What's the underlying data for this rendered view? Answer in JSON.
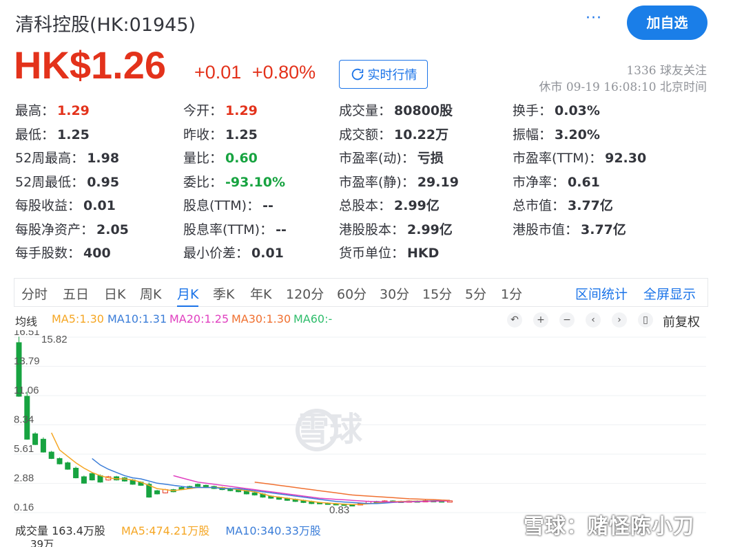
{
  "header": {
    "title": "清科控股(HK:01945)",
    "more_label": "···",
    "follow_button": "加自选",
    "price": "HK$1.26",
    "change": "+0.01",
    "change_pct": "+0.80%",
    "realtime_button": "实时行情",
    "fans": "1336 球友关注",
    "status": "休市 09-19 16:08:10 北京时间"
  },
  "quote": [
    {
      "label": "最高：",
      "value": "1.29",
      "color": "up"
    },
    {
      "label": "今开：",
      "value": "1.29",
      "color": "up"
    },
    {
      "label": "成交量：",
      "value": "80800股",
      "color": ""
    },
    {
      "label": "换手：",
      "value": "0.03%",
      "color": ""
    },
    {
      "label": "最低：",
      "value": "1.25",
      "color": ""
    },
    {
      "label": "昨收：",
      "value": "1.25",
      "color": ""
    },
    {
      "label": "成交额：",
      "value": "10.22万",
      "color": ""
    },
    {
      "label": "振幅：",
      "value": "3.20%",
      "color": ""
    },
    {
      "label": "52周最高：",
      "value": "1.98",
      "color": ""
    },
    {
      "label": "量比：",
      "value": "0.60",
      "color": "down"
    },
    {
      "label": "市盈率(动)：",
      "value": "亏损",
      "color": ""
    },
    {
      "label": "市盈率(TTM)：",
      "value": "92.30",
      "color": ""
    },
    {
      "label": "52周最低：",
      "value": "0.95",
      "color": ""
    },
    {
      "label": "委比：",
      "value": "-93.10%",
      "color": "down"
    },
    {
      "label": "市盈率(静)：",
      "value": "29.19",
      "color": ""
    },
    {
      "label": "市净率：",
      "value": "0.61",
      "color": ""
    },
    {
      "label": "每股收益：",
      "value": "0.01",
      "color": ""
    },
    {
      "label": "股息(TTM)：",
      "value": "--",
      "color": ""
    },
    {
      "label": "总股本：",
      "value": "2.99亿",
      "color": ""
    },
    {
      "label": "总市值：",
      "value": "3.77亿",
      "color": ""
    },
    {
      "label": "每股净资产：",
      "value": "2.05",
      "color": ""
    },
    {
      "label": "股息率(TTM)：",
      "value": "--",
      "color": ""
    },
    {
      "label": "港股股本：",
      "value": "2.99亿",
      "color": ""
    },
    {
      "label": "港股市值：",
      "value": "3.77亿",
      "color": ""
    },
    {
      "label": "每手股数：",
      "value": "400",
      "color": ""
    },
    {
      "label": "最小价差：",
      "value": "0.01",
      "color": ""
    },
    {
      "label": "货币单位：",
      "value": "HKD",
      "color": ""
    }
  ],
  "tabs": [
    "分时",
    "五日",
    "日K",
    "周K",
    "月K",
    "季K",
    "年K",
    "120分",
    "60分",
    "30分",
    "15分",
    "5分",
    "1分"
  ],
  "active_tab": "月K",
  "tab_links": [
    "区间统计",
    "全屏显示"
  ],
  "ma": {
    "label": "均线",
    "items": [
      {
        "text": "MA5:1.30",
        "color": "#f5a623"
      },
      {
        "text": "MA10:1.31",
        "color": "#3b7dd8"
      },
      {
        "text": "MA20:1.25",
        "color": "#e040c0"
      },
      {
        "text": "MA30:1.30",
        "color": "#f07030"
      },
      {
        "text": "MA60:-",
        "color": "#2ebd6b"
      }
    ]
  },
  "tools": [
    {
      "icon": "undo-icon",
      "glyph": "↶"
    },
    {
      "icon": "zoom-in-icon",
      "glyph": "+"
    },
    {
      "icon": "zoom-out-icon",
      "glyph": "−"
    },
    {
      "icon": "prev-icon",
      "glyph": "‹"
    },
    {
      "icon": "next-icon",
      "glyph": "›"
    },
    {
      "icon": "candle-icon",
      "glyph": "▯"
    }
  ],
  "fuquan_label": "前复权",
  "chart_data": {
    "type": "candlestick",
    "y_ticks": [
      "16.51",
      "13.79",
      "11.06",
      "8.34",
      "5.61",
      "2.88",
      "0.16"
    ],
    "max_label": "15.82",
    "min_label": "0.83",
    "ylim": [
      0.16,
      16.51
    ],
    "candles": [
      [
        16.0,
        11.0
      ],
      [
        11.0,
        7.0
      ],
      [
        7.5,
        6.5
      ],
      [
        7.0,
        5.8
      ],
      [
        5.8,
        5.2
      ],
      [
        5.2,
        4.7
      ],
      [
        4.8,
        4.2
      ],
      [
        4.3,
        3.4
      ],
      [
        3.5,
        2.9
      ],
      [
        3.8,
        3.2
      ],
      [
        3.6,
        3.0
      ],
      [
        3.2,
        3.5
      ],
      [
        3.5,
        3.2
      ],
      [
        3.4,
        3.1
      ],
      [
        3.2,
        2.8
      ],
      [
        3.0,
        2.7
      ],
      [
        2.8,
        1.6
      ],
      [
        2.2,
        1.9
      ],
      [
        2.0,
        2.3
      ],
      [
        2.3,
        2.1
      ],
      [
        2.5,
        2.3
      ],
      [
        2.6,
        2.4
      ],
      [
        2.8,
        2.6
      ],
      [
        2.7,
        2.5
      ],
      [
        2.6,
        2.4
      ],
      [
        2.5,
        2.3
      ],
      [
        2.4,
        2.2
      ],
      [
        2.3,
        2.1
      ],
      [
        2.2,
        1.9
      ],
      [
        2.0,
        1.8
      ],
      [
        1.9,
        1.6
      ],
      [
        1.7,
        1.5
      ],
      [
        1.6,
        1.4
      ],
      [
        1.5,
        1.3
      ],
      [
        1.4,
        1.2
      ],
      [
        1.3,
        1.1
      ],
      [
        1.2,
        1.0
      ],
      [
        1.1,
        1.0
      ],
      [
        1.05,
        0.95
      ],
      [
        1.0,
        0.9
      ],
      [
        0.95,
        0.9
      ],
      [
        0.9,
        0.85
      ],
      [
        0.9,
        1.0
      ],
      [
        1.0,
        1.2
      ],
      [
        1.2,
        1.1
      ],
      [
        1.15,
        1.25
      ],
      [
        1.25,
        1.2
      ],
      [
        1.22,
        1.18
      ],
      [
        1.2,
        1.25
      ],
      [
        1.25,
        1.22
      ],
      [
        1.22,
        1.28
      ],
      [
        1.28,
        1.26
      ],
      [
        1.26,
        1.22
      ],
      [
        1.22,
        1.26
      ]
    ],
    "ma5": [
      null,
      null,
      null,
      null,
      7.6,
      6.0,
      5.4,
      4.8,
      4.3,
      3.9,
      3.6,
      3.4,
      3.3,
      3.3,
      3.2,
      3.0,
      2.7,
      2.4,
      2.3,
      2.2,
      2.3,
      2.4,
      2.5,
      2.5,
      2.5,
      2.5,
      2.4,
      2.3,
      2.2,
      2.1,
      1.9,
      1.7,
      1.6,
      1.5,
      1.4,
      1.3,
      1.2,
      1.1,
      1.05,
      1.0,
      0.95,
      0.92,
      0.93,
      0.98,
      1.05,
      1.12,
      1.18,
      1.2,
      1.22,
      1.23,
      1.24,
      1.26,
      1.27,
      1.3
    ],
    "ma10": [
      null,
      null,
      null,
      null,
      null,
      null,
      null,
      null,
      null,
      5.2,
      4.6,
      4.2,
      3.9,
      3.6,
      3.4,
      3.3,
      3.1,
      2.9,
      2.8,
      2.7,
      2.6,
      2.5,
      2.5,
      2.5,
      2.5,
      2.4,
      2.4,
      2.4,
      2.3,
      2.2,
      2.1,
      2.0,
      1.9,
      1.8,
      1.7,
      1.6,
      1.5,
      1.4,
      1.3,
      1.2,
      1.15,
      1.1,
      1.05,
      1.0,
      1.0,
      1.05,
      1.1,
      1.15,
      1.18,
      1.2,
      1.22,
      1.25,
      1.28,
      1.31
    ],
    "ma20": [
      null,
      null,
      null,
      null,
      null,
      null,
      null,
      null,
      null,
      null,
      null,
      null,
      null,
      null,
      null,
      null,
      null,
      null,
      null,
      3.6,
      3.4,
      3.2,
      3.0,
      2.9,
      2.8,
      2.7,
      2.6,
      2.5,
      2.4,
      2.3,
      2.2,
      2.1,
      2.0,
      1.9,
      1.8,
      1.7,
      1.6,
      1.5,
      1.45,
      1.4,
      1.35,
      1.3,
      1.25,
      1.2,
      1.18,
      1.16,
      1.15,
      1.15,
      1.16,
      1.18,
      1.2,
      1.22,
      1.24,
      1.25
    ],
    "ma30": [
      null,
      null,
      null,
      null,
      null,
      null,
      null,
      null,
      null,
      null,
      null,
      null,
      null,
      null,
      null,
      null,
      null,
      null,
      null,
      null,
      null,
      null,
      null,
      null,
      null,
      null,
      null,
      null,
      null,
      3.0,
      2.9,
      2.8,
      2.7,
      2.6,
      2.5,
      2.4,
      2.3,
      2.2,
      2.1,
      2.0,
      1.9,
      1.8,
      1.75,
      1.7,
      1.65,
      1.6,
      1.55,
      1.5,
      1.45,
      1.42,
      1.4,
      1.37,
      1.33,
      1.3
    ]
  },
  "volume_row": {
    "label": "成交量 163.4万股",
    "ma5": "MA5:474.21万股",
    "ma10": "MA10:340.33万股",
    "axis_label": "39万"
  },
  "watermark_center": "雪球",
  "watermark_corner": "雪球：赌怪陈小刀"
}
